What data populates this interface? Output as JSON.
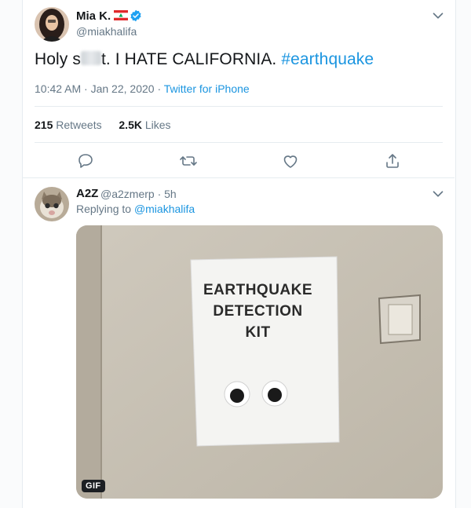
{
  "tweet": {
    "name": "Mia K.",
    "handle": "@miakhalifa",
    "text_part1": "Holy s",
    "text_part2": "t. I HATE CALIFORNIA.",
    "hashtag": "#earthquake",
    "time": "10:42 AM · Jan 22, 2020 · ",
    "source": "Twitter for iPhone",
    "retweets_count": "215",
    "retweets_label": "Retweets",
    "likes_count": "2.5K",
    "likes_label": "Likes"
  },
  "reply": {
    "name": "A2Z",
    "handle_time": "@a2zmerp · 5h",
    "replying_to_label": "Replying to ",
    "replying_to_user": "@miakhalifa",
    "media": {
      "sign_line1": "EARTHQUAKE",
      "sign_line2": "DETECTION",
      "sign_line3": "KIT",
      "badge": "GIF"
    }
  },
  "icons": [
    "verified-badge-icon",
    "lebanon-flag-icon",
    "chevron-down-icon",
    "reply-icon",
    "retweet-icon",
    "like-icon",
    "share-icon"
  ],
  "colors": {
    "link": "#1b95e0",
    "muted": "#657786",
    "text": "#14171a",
    "verified": "#1da1f2",
    "flag_red": "#e0292b"
  }
}
